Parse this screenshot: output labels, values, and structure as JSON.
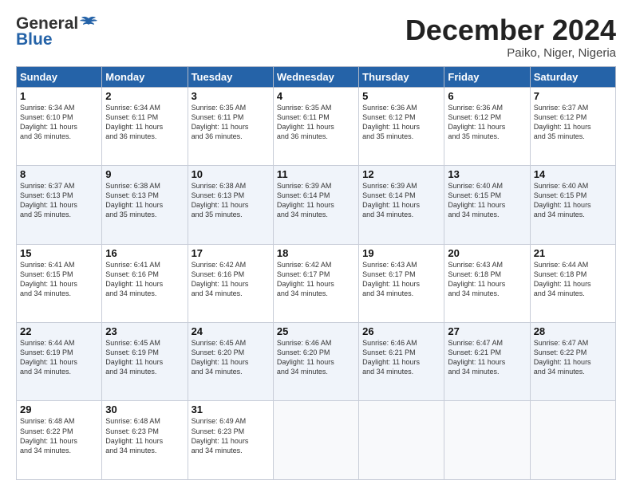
{
  "logo": {
    "general": "General",
    "blue": "Blue"
  },
  "header": {
    "month": "December 2024",
    "location": "Paiko, Niger, Nigeria"
  },
  "days_of_week": [
    "Sunday",
    "Monday",
    "Tuesday",
    "Wednesday",
    "Thursday",
    "Friday",
    "Saturday"
  ],
  "weeks": [
    [
      {
        "day": "1",
        "info": "Sunrise: 6:34 AM\nSunset: 6:10 PM\nDaylight: 11 hours\nand 36 minutes."
      },
      {
        "day": "2",
        "info": "Sunrise: 6:34 AM\nSunset: 6:11 PM\nDaylight: 11 hours\nand 36 minutes."
      },
      {
        "day": "3",
        "info": "Sunrise: 6:35 AM\nSunset: 6:11 PM\nDaylight: 11 hours\nand 36 minutes."
      },
      {
        "day": "4",
        "info": "Sunrise: 6:35 AM\nSunset: 6:11 PM\nDaylight: 11 hours\nand 36 minutes."
      },
      {
        "day": "5",
        "info": "Sunrise: 6:36 AM\nSunset: 6:12 PM\nDaylight: 11 hours\nand 35 minutes."
      },
      {
        "day": "6",
        "info": "Sunrise: 6:36 AM\nSunset: 6:12 PM\nDaylight: 11 hours\nand 35 minutes."
      },
      {
        "day": "7",
        "info": "Sunrise: 6:37 AM\nSunset: 6:12 PM\nDaylight: 11 hours\nand 35 minutes."
      }
    ],
    [
      {
        "day": "8",
        "info": "Sunrise: 6:37 AM\nSunset: 6:13 PM\nDaylight: 11 hours\nand 35 minutes."
      },
      {
        "day": "9",
        "info": "Sunrise: 6:38 AM\nSunset: 6:13 PM\nDaylight: 11 hours\nand 35 minutes."
      },
      {
        "day": "10",
        "info": "Sunrise: 6:38 AM\nSunset: 6:13 PM\nDaylight: 11 hours\nand 35 minutes."
      },
      {
        "day": "11",
        "info": "Sunrise: 6:39 AM\nSunset: 6:14 PM\nDaylight: 11 hours\nand 34 minutes."
      },
      {
        "day": "12",
        "info": "Sunrise: 6:39 AM\nSunset: 6:14 PM\nDaylight: 11 hours\nand 34 minutes."
      },
      {
        "day": "13",
        "info": "Sunrise: 6:40 AM\nSunset: 6:15 PM\nDaylight: 11 hours\nand 34 minutes."
      },
      {
        "day": "14",
        "info": "Sunrise: 6:40 AM\nSunset: 6:15 PM\nDaylight: 11 hours\nand 34 minutes."
      }
    ],
    [
      {
        "day": "15",
        "info": "Sunrise: 6:41 AM\nSunset: 6:15 PM\nDaylight: 11 hours\nand 34 minutes."
      },
      {
        "day": "16",
        "info": "Sunrise: 6:41 AM\nSunset: 6:16 PM\nDaylight: 11 hours\nand 34 minutes."
      },
      {
        "day": "17",
        "info": "Sunrise: 6:42 AM\nSunset: 6:16 PM\nDaylight: 11 hours\nand 34 minutes."
      },
      {
        "day": "18",
        "info": "Sunrise: 6:42 AM\nSunset: 6:17 PM\nDaylight: 11 hours\nand 34 minutes."
      },
      {
        "day": "19",
        "info": "Sunrise: 6:43 AM\nSunset: 6:17 PM\nDaylight: 11 hours\nand 34 minutes."
      },
      {
        "day": "20",
        "info": "Sunrise: 6:43 AM\nSunset: 6:18 PM\nDaylight: 11 hours\nand 34 minutes."
      },
      {
        "day": "21",
        "info": "Sunrise: 6:44 AM\nSunset: 6:18 PM\nDaylight: 11 hours\nand 34 minutes."
      }
    ],
    [
      {
        "day": "22",
        "info": "Sunrise: 6:44 AM\nSunset: 6:19 PM\nDaylight: 11 hours\nand 34 minutes."
      },
      {
        "day": "23",
        "info": "Sunrise: 6:45 AM\nSunset: 6:19 PM\nDaylight: 11 hours\nand 34 minutes."
      },
      {
        "day": "24",
        "info": "Sunrise: 6:45 AM\nSunset: 6:20 PM\nDaylight: 11 hours\nand 34 minutes."
      },
      {
        "day": "25",
        "info": "Sunrise: 6:46 AM\nSunset: 6:20 PM\nDaylight: 11 hours\nand 34 minutes."
      },
      {
        "day": "26",
        "info": "Sunrise: 6:46 AM\nSunset: 6:21 PM\nDaylight: 11 hours\nand 34 minutes."
      },
      {
        "day": "27",
        "info": "Sunrise: 6:47 AM\nSunset: 6:21 PM\nDaylight: 11 hours\nand 34 minutes."
      },
      {
        "day": "28",
        "info": "Sunrise: 6:47 AM\nSunset: 6:22 PM\nDaylight: 11 hours\nand 34 minutes."
      }
    ],
    [
      {
        "day": "29",
        "info": "Sunrise: 6:48 AM\nSunset: 6:22 PM\nDaylight: 11 hours\nand 34 minutes."
      },
      {
        "day": "30",
        "info": "Sunrise: 6:48 AM\nSunset: 6:23 PM\nDaylight: 11 hours\nand 34 minutes."
      },
      {
        "day": "31",
        "info": "Sunrise: 6:49 AM\nSunset: 6:23 PM\nDaylight: 11 hours\nand 34 minutes."
      },
      null,
      null,
      null,
      null
    ]
  ]
}
